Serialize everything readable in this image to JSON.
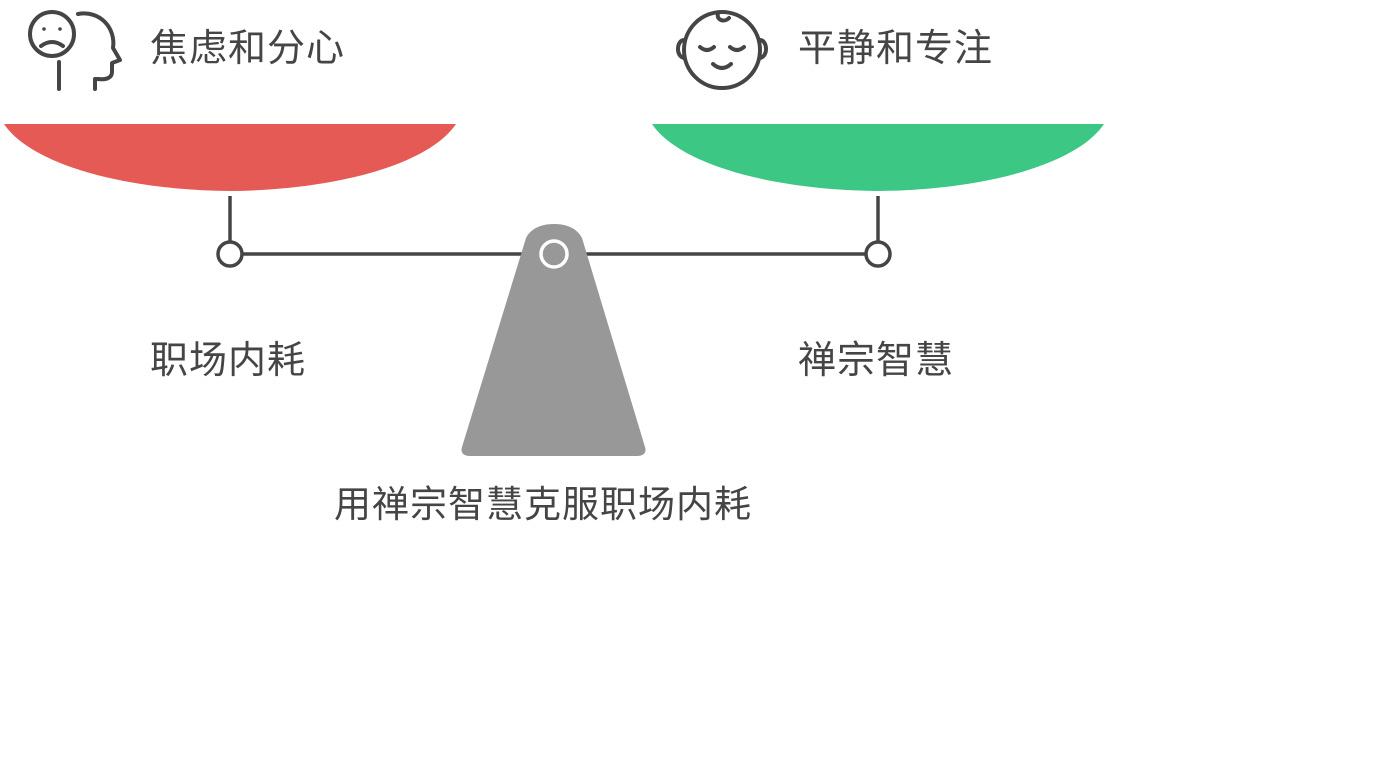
{
  "left": {
    "heading": "焦虑和分心",
    "concept": "职场内耗",
    "icon": "anxious-head-icon",
    "color": "#E65A55"
  },
  "right": {
    "heading": "平静和专注",
    "concept": "禅宗智慧",
    "icon": "calm-baby-face-icon",
    "color": "#3DC784"
  },
  "title": "用禅宗智慧克服职场内耗",
  "colors": {
    "stroke": "#454545",
    "fulcrum": "#989898"
  }
}
